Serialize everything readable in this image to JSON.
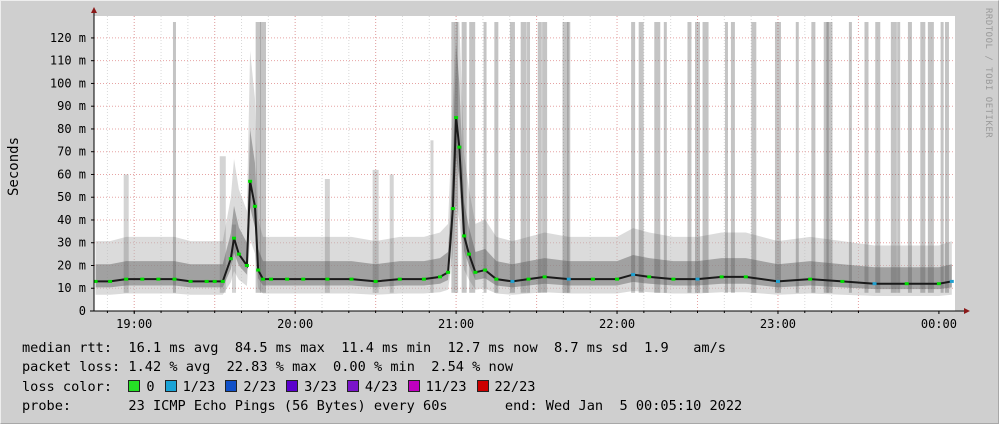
{
  "chart_data": {
    "type": "line",
    "ylabel": "Seconds",
    "ylim": [
      0,
      127
    ],
    "xlim": [
      18.75,
      24.1
    ],
    "grid": true,
    "yticks": [
      {
        "v": 0,
        "label": "0"
      },
      {
        "v": 10,
        "label": "10 m"
      },
      {
        "v": 20,
        "label": "20 m"
      },
      {
        "v": 30,
        "label": "30 m"
      },
      {
        "v": 40,
        "label": "40 m"
      },
      {
        "v": 50,
        "label": "50 m"
      },
      {
        "v": 60,
        "label": "60 m"
      },
      {
        "v": 70,
        "label": "70 m"
      },
      {
        "v": 80,
        "label": "80 m"
      },
      {
        "v": 90,
        "label": "90 m"
      },
      {
        "v": 100,
        "label": "100 m"
      },
      {
        "v": 110,
        "label": "110 m"
      },
      {
        "v": 120,
        "label": "120 m"
      }
    ],
    "xticks": [
      {
        "v": 19,
        "label": "19:00"
      },
      {
        "v": 20,
        "label": "20:00"
      },
      {
        "v": 21,
        "label": "21:00"
      },
      {
        "v": 22,
        "label": "22:00"
      },
      {
        "v": 23,
        "label": "23:00"
      },
      {
        "v": 24,
        "label": "00:00"
      }
    ],
    "colors": {
      "background": "#cfcfcf",
      "plot_bg": "#ffffff",
      "grid_major": "#e6a3a3",
      "grid_minor": "#d8d8d8",
      "axis": "#000000",
      "arrow": "#8b1a1a",
      "smoke": "#555555",
      "median_loss0": "#00dd00",
      "median_loss1": "#1fa0d0"
    },
    "series": [
      {
        "name": "median rtt",
        "x": [
          18.76,
          18.85,
          18.95,
          19.05,
          19.15,
          19.25,
          19.35,
          19.45,
          19.5,
          19.55,
          19.6,
          19.62,
          19.65,
          19.7,
          19.72,
          19.75,
          19.77,
          19.8,
          19.85,
          19.95,
          20.05,
          20.2,
          20.35,
          20.5,
          20.65,
          20.8,
          20.9,
          20.95,
          20.98,
          21.0,
          21.02,
          21.05,
          21.08,
          21.12,
          21.18,
          21.25,
          21.35,
          21.45,
          21.55,
          21.7,
          21.85,
          22.0,
          22.1,
          22.2,
          22.35,
          22.5,
          22.65,
          22.8,
          23.0,
          23.2,
          23.4,
          23.6,
          23.8,
          24.0,
          24.08
        ],
        "y": [
          13,
          13,
          14,
          14,
          14,
          14,
          13,
          13,
          13,
          13,
          23,
          32,
          25,
          20,
          57,
          46,
          18,
          14,
          14,
          14,
          14,
          14,
          14,
          13,
          14,
          14,
          15,
          17,
          45,
          85,
          72,
          33,
          25,
          17,
          18,
          14,
          13,
          14,
          15,
          14,
          14,
          14,
          16,
          15,
          14,
          14,
          15,
          15,
          13,
          14,
          13,
          12,
          12,
          12,
          13
        ],
        "loss_color_from_x": 21.2
      }
    ],
    "smoke_bands": [
      {
        "x": 19.25,
        "top": 127
      },
      {
        "x": 19.62,
        "top": 38
      },
      {
        "x": 19.77,
        "top": 127
      },
      {
        "x": 19.8,
        "top": 127
      },
      {
        "x": 20.98,
        "top": 127
      },
      {
        "x": 21.0,
        "top": 127
      },
      {
        "x": 21.05,
        "top": 127
      },
      {
        "x": 21.1,
        "top": 127
      },
      {
        "x": 21.18,
        "top": 127
      },
      {
        "x": 21.25,
        "top": 127
      },
      {
        "x": 21.35,
        "top": 127
      },
      {
        "x": 21.42,
        "top": 127
      },
      {
        "x": 21.45,
        "top": 127
      },
      {
        "x": 21.52,
        "top": 127
      },
      {
        "x": 21.55,
        "top": 127
      },
      {
        "x": 21.68,
        "top": 127
      },
      {
        "x": 21.7,
        "top": 127
      },
      {
        "x": 22.1,
        "top": 127
      },
      {
        "x": 22.15,
        "top": 127
      },
      {
        "x": 22.25,
        "top": 127
      },
      {
        "x": 22.3,
        "top": 127
      },
      {
        "x": 22.45,
        "top": 127
      },
      {
        "x": 22.5,
        "top": 127
      },
      {
        "x": 22.55,
        "top": 127
      },
      {
        "x": 22.68,
        "top": 127
      },
      {
        "x": 22.72,
        "top": 127
      },
      {
        "x": 22.85,
        "top": 127
      },
      {
        "x": 23.0,
        "top": 127
      },
      {
        "x": 23.12,
        "top": 127
      },
      {
        "x": 23.22,
        "top": 127
      },
      {
        "x": 23.3,
        "top": 127
      },
      {
        "x": 23.32,
        "top": 127
      },
      {
        "x": 23.45,
        "top": 127
      },
      {
        "x": 23.55,
        "top": 127
      },
      {
        "x": 23.62,
        "top": 127
      },
      {
        "x": 23.72,
        "top": 127
      },
      {
        "x": 23.75,
        "top": 127
      },
      {
        "x": 23.82,
        "top": 127
      },
      {
        "x": 23.9,
        "top": 127
      },
      {
        "x": 23.95,
        "top": 127
      },
      {
        "x": 24.02,
        "top": 127
      },
      {
        "x": 24.05,
        "top": 127
      },
      {
        "x": 20.2,
        "top": 58
      },
      {
        "x": 20.5,
        "top": 62
      },
      {
        "x": 20.85,
        "top": 75
      },
      {
        "x": 20.6,
        "top": 60
      },
      {
        "x": 18.95,
        "top": 60
      },
      {
        "x": 19.55,
        "top": 68
      }
    ]
  },
  "watermark": "RRDTOOL / TOBI OETIKER",
  "legend": {
    "rtt": {
      "label": "median rtt:",
      "avg": "16.1 ms avg",
      "max": "84.5 ms max",
      "min": "11.4 ms min",
      "now": "12.7 ms now",
      "sd": "8.7 ms sd",
      "am": "1.9",
      "am_unit": "am/s"
    },
    "loss": {
      "label": "packet loss:",
      "avg": "1.42 % avg",
      "max": "22.83 % max",
      "min": "0.00 % min",
      "now": "2.54 % now"
    },
    "loss_color": {
      "label": "loss color:",
      "items": [
        {
          "label": "0",
          "color": "#26e026"
        },
        {
          "label": "1/23",
          "color": "#1aa3d6"
        },
        {
          "label": "2/23",
          "color": "#1050c8"
        },
        {
          "label": "3/23",
          "color": "#5a00cc"
        },
        {
          "label": "4/23",
          "color": "#7a14c8"
        },
        {
          "label": "11/23",
          "color": "#c000c0"
        },
        {
          "label": "22/23",
          "color": "#cc0000"
        }
      ]
    },
    "probe": {
      "label": "probe:",
      "desc": "23 ICMP Echo Pings (56 Bytes) every 60s",
      "end": "end: Wed Jan  5 00:05:10 2022"
    }
  }
}
